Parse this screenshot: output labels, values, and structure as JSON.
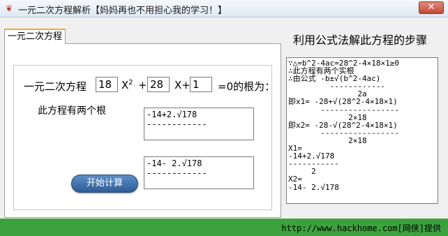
{
  "window": {
    "title": "一元二次方程解析【妈妈再也不用担心我的学习！】",
    "close_label": "✕"
  },
  "tab": {
    "label": "一元二次方程"
  },
  "equation": {
    "prefix": "一元二次方程",
    "a_value": "18",
    "x2_label": "X",
    "x2_exponent": "2",
    "plus_label": "+",
    "b_value": "28",
    "x_plus_label": "X+",
    "c_value": "1",
    "suffix": "=0的根为："
  },
  "result": {
    "label": "此方程有两个根",
    "root1_lines": [
      "-14+2.√178",
      "------------"
    ],
    "root2_lines": [
      "-14- 2.√178",
      "------------"
    ]
  },
  "start_button": {
    "label": "开始计算"
  },
  "steps": {
    "heading": "利用公式法解此方程的步骤",
    "lines": [
      "∵△=b^2-4ac=28^2-4×18×1≥0",
      "∴此方程有两个实根",
      "∴由公式 -b±√(b^2-4ac)",
      "         ------------",
      "               2a",
      "即x1= -28+√(28^2-4×18×1)",
      "       -----------------",
      "             2×18",
      "即x2= -28-√(28^2-4×18×1)",
      "       -----------------",
      "             2×18",
      "X1=",
      "-14+2.√178",
      "-----------",
      "     2",
      "X2=",
      "-14- 2.√178"
    ]
  },
  "footer": {
    "text": "http://www.hackhome.com[网侠]提供"
  }
}
